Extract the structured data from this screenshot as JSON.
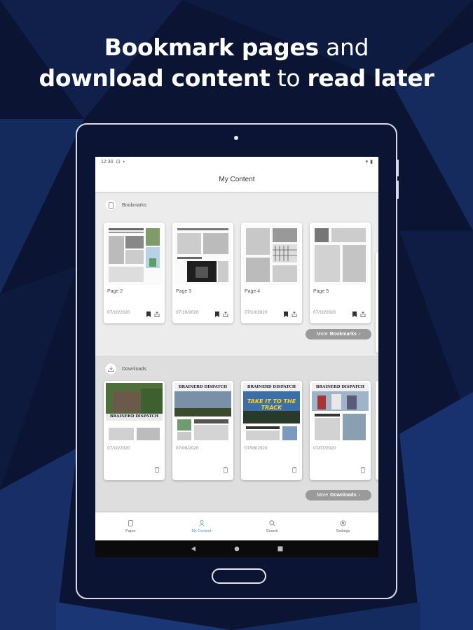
{
  "headline": {
    "line1_bold": "Bookmark pages",
    "line1_light": " and",
    "line2_bold_a": "download content",
    "line2_light": " to ",
    "line2_bold_b": "read later"
  },
  "status_bar": {
    "time": "12:30"
  },
  "app_bar": {
    "title": "My Content"
  },
  "bookmarks": {
    "section_label": "Bookmarks",
    "items": [
      {
        "title": "Page 2",
        "date": "07/10/2020"
      },
      {
        "title": "Page 3",
        "date": "07/10/2020"
      },
      {
        "title": "Page 4",
        "date": "07/10/2020"
      },
      {
        "title": "Page 5",
        "date": "07/10/2020"
      }
    ],
    "more_label_prefix": "More",
    "more_label_bold": "Bookmarks"
  },
  "downloads": {
    "section_label": "Downloads",
    "items": [
      {
        "date": "07/10/2020"
      },
      {
        "date": "07/09/2020"
      },
      {
        "date": "07/08/2020"
      },
      {
        "date": "07/07/2020"
      }
    ],
    "masthead": "BRAINERD DISPATCH",
    "cover_headline_3": "TAKE IT TO THE TRACK",
    "more_label_prefix": "More",
    "more_label_bold": "Downloads"
  },
  "bottom_nav": {
    "items": [
      {
        "label": "Paper",
        "icon": "paper-icon"
      },
      {
        "label": "My Content",
        "icon": "person-icon",
        "active": true
      },
      {
        "label": "Search",
        "icon": "search-icon"
      },
      {
        "label": "Settings",
        "icon": "gear-icon"
      }
    ]
  },
  "colors": {
    "accent": "#4a8fd6",
    "background": "#0a1430",
    "more_button": "#9a9a9a"
  }
}
